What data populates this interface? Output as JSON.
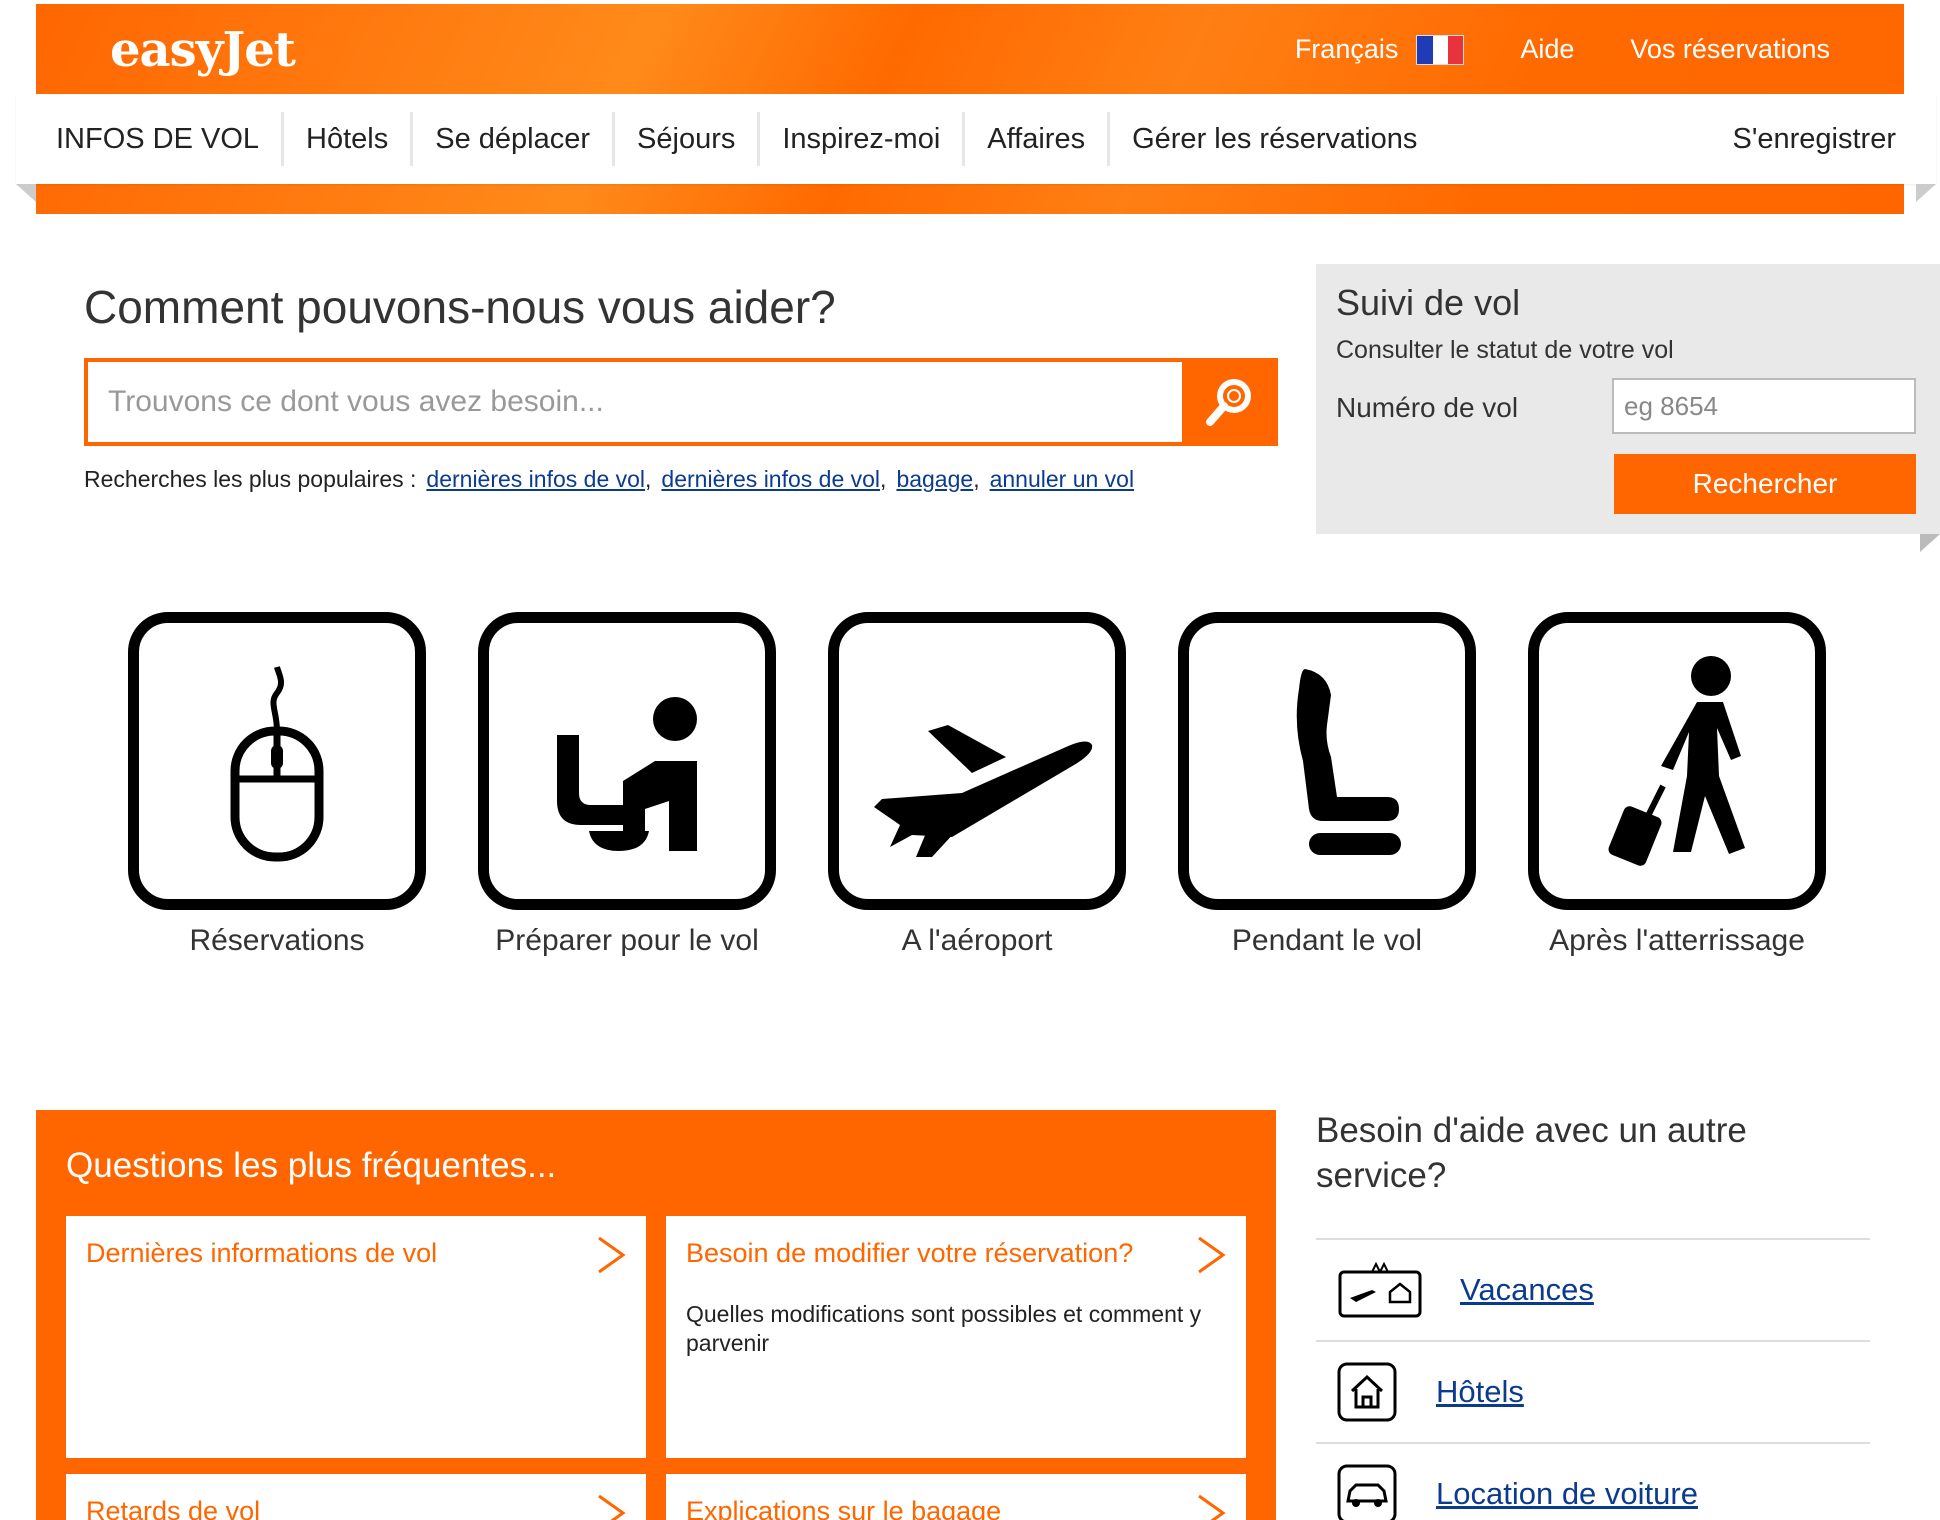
{
  "header": {
    "logo": "easyJet",
    "language": "Français",
    "help": "Aide",
    "bookings": "Vos réservations"
  },
  "nav": {
    "items": [
      "INFOS DE VOL",
      "Hôtels",
      "Se déplacer",
      "Séjours",
      "Inspirez-moi",
      "Affaires",
      "Gérer les réservations"
    ],
    "checkin": "S'enregistrer"
  },
  "help": {
    "title": "Comment pouvons-nous vous aider?",
    "search_placeholder": "Trouvons ce dont vous avez besoin...",
    "popular_label": "Recherches les plus populaires :",
    "popular_links": [
      "dernières infos de vol",
      "dernières infos de vol",
      "bagage",
      "annuler un vol"
    ]
  },
  "tracker": {
    "title": "Suivi de vol",
    "subtitle": "Consulter le statut de votre vol",
    "flight_label": "Numéro de vol",
    "flight_placeholder": "eg 8654",
    "button": "Rechercher"
  },
  "categories": [
    {
      "label": "Réservations",
      "icon": "mouse-icon"
    },
    {
      "label": "Préparer pour le vol",
      "icon": "check-in-desk-icon"
    },
    {
      "label": "A l'aéroport",
      "icon": "plane-takeoff-icon"
    },
    {
      "label": "Pendant le vol",
      "icon": "seat-icon"
    },
    {
      "label": "Après l'atterrissage",
      "icon": "walking-with-luggage-icon"
    }
  ],
  "faq": {
    "title": "Questions les plus fréquentes...",
    "cards": [
      {
        "title": "Dernières informations de vol",
        "desc": ""
      },
      {
        "title": "Besoin de modifier votre réservation?",
        "desc": "Quelles modifications sont possibles et comment y parvenir"
      },
      {
        "title": "Retards de vol",
        "desc": ""
      },
      {
        "title": "Explications sur le bagage",
        "desc": ""
      }
    ]
  },
  "other_services": {
    "title": "Besoin d'aide avec un autre service?",
    "items": [
      {
        "label": "Vacances",
        "icon": "holidays-icon"
      },
      {
        "label": "Hôtels",
        "icon": "hotel-icon"
      },
      {
        "label": "Location de voiture",
        "icon": "car-icon"
      }
    ]
  },
  "colors": {
    "brand": "#ff6600",
    "link": "#0b3b8f"
  }
}
